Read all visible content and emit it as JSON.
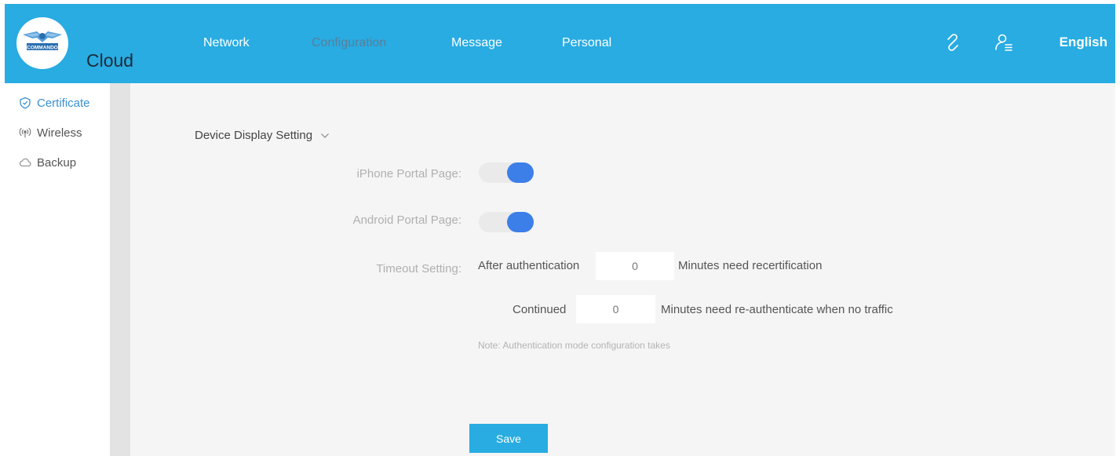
{
  "header": {
    "brand": "Cloud",
    "logo_text": "COMMANDO",
    "nav": [
      {
        "label": "Network",
        "active": false
      },
      {
        "label": "Configuration",
        "active": true
      },
      {
        "label": "Message",
        "active": false
      },
      {
        "label": "Personal",
        "active": false
      }
    ],
    "icons": [
      "link-icon",
      "user-list-icon"
    ],
    "language": "English"
  },
  "sidebar": {
    "items": [
      {
        "label": "Certificate",
        "icon": "shield-icon",
        "active": true
      },
      {
        "label": "Wireless",
        "icon": "wireless-icon",
        "active": false
      },
      {
        "label": "Backup",
        "icon": "cloud-icon",
        "active": false
      }
    ]
  },
  "main": {
    "section_title": "Device Display Setting",
    "iphone_label": "iPhone Portal Page:",
    "iphone_enabled": true,
    "android_label": "Android Portal Page:",
    "android_enabled": true,
    "timeout_label": "Timeout Setting:",
    "after_auth_text": "After authentication",
    "after_auth_value": "0",
    "after_auth_suffix": "Minutes need recertification",
    "continued_text": "Continued",
    "continued_value": "0",
    "continued_suffix": "Minutes need re-authenticate when no traffic",
    "note": "Note: Authentication mode configuration takes",
    "save_label": "Save"
  },
  "colors": {
    "header": "#28ace2",
    "toggle_on": "#3c7fe9",
    "active_link": "#3a8fd0"
  }
}
